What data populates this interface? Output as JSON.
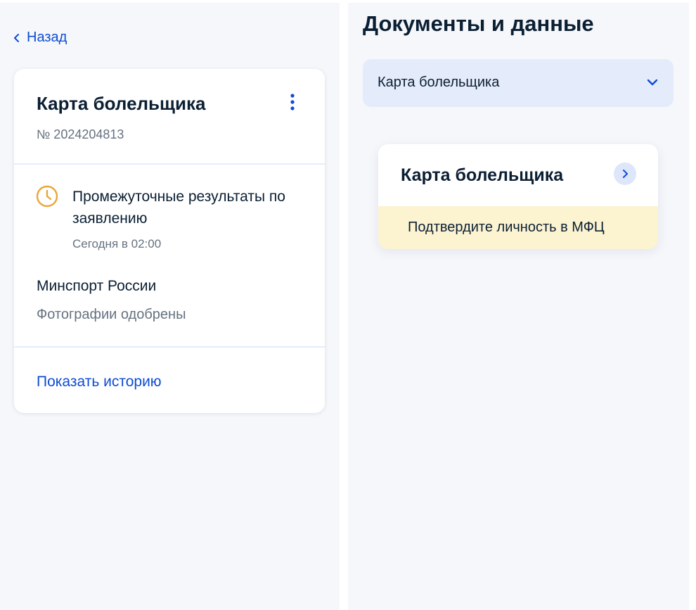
{
  "left": {
    "back_label": "Назад",
    "card": {
      "title": "Карта болельщика",
      "number": "№ 2024204813",
      "status": {
        "text": "Промежуточные результаты по заявлению",
        "time": "Сегодня в 02:00",
        "icon": "clock-icon"
      },
      "org": "Минспорт России",
      "org_status": "Фотографии одобрены",
      "history_link": "Показать историю"
    }
  },
  "right": {
    "title": "Документы и данные",
    "select": {
      "value": "Карта болельщика"
    },
    "doc_card": {
      "title": "Карта болельщика",
      "note": "Подтвердите личность в МФЦ"
    }
  },
  "colors": {
    "accent": "#0d4cd3",
    "clock": "#e9a63a",
    "note_bg": "#fcf3d1",
    "select_bg": "#e4ebfa"
  }
}
